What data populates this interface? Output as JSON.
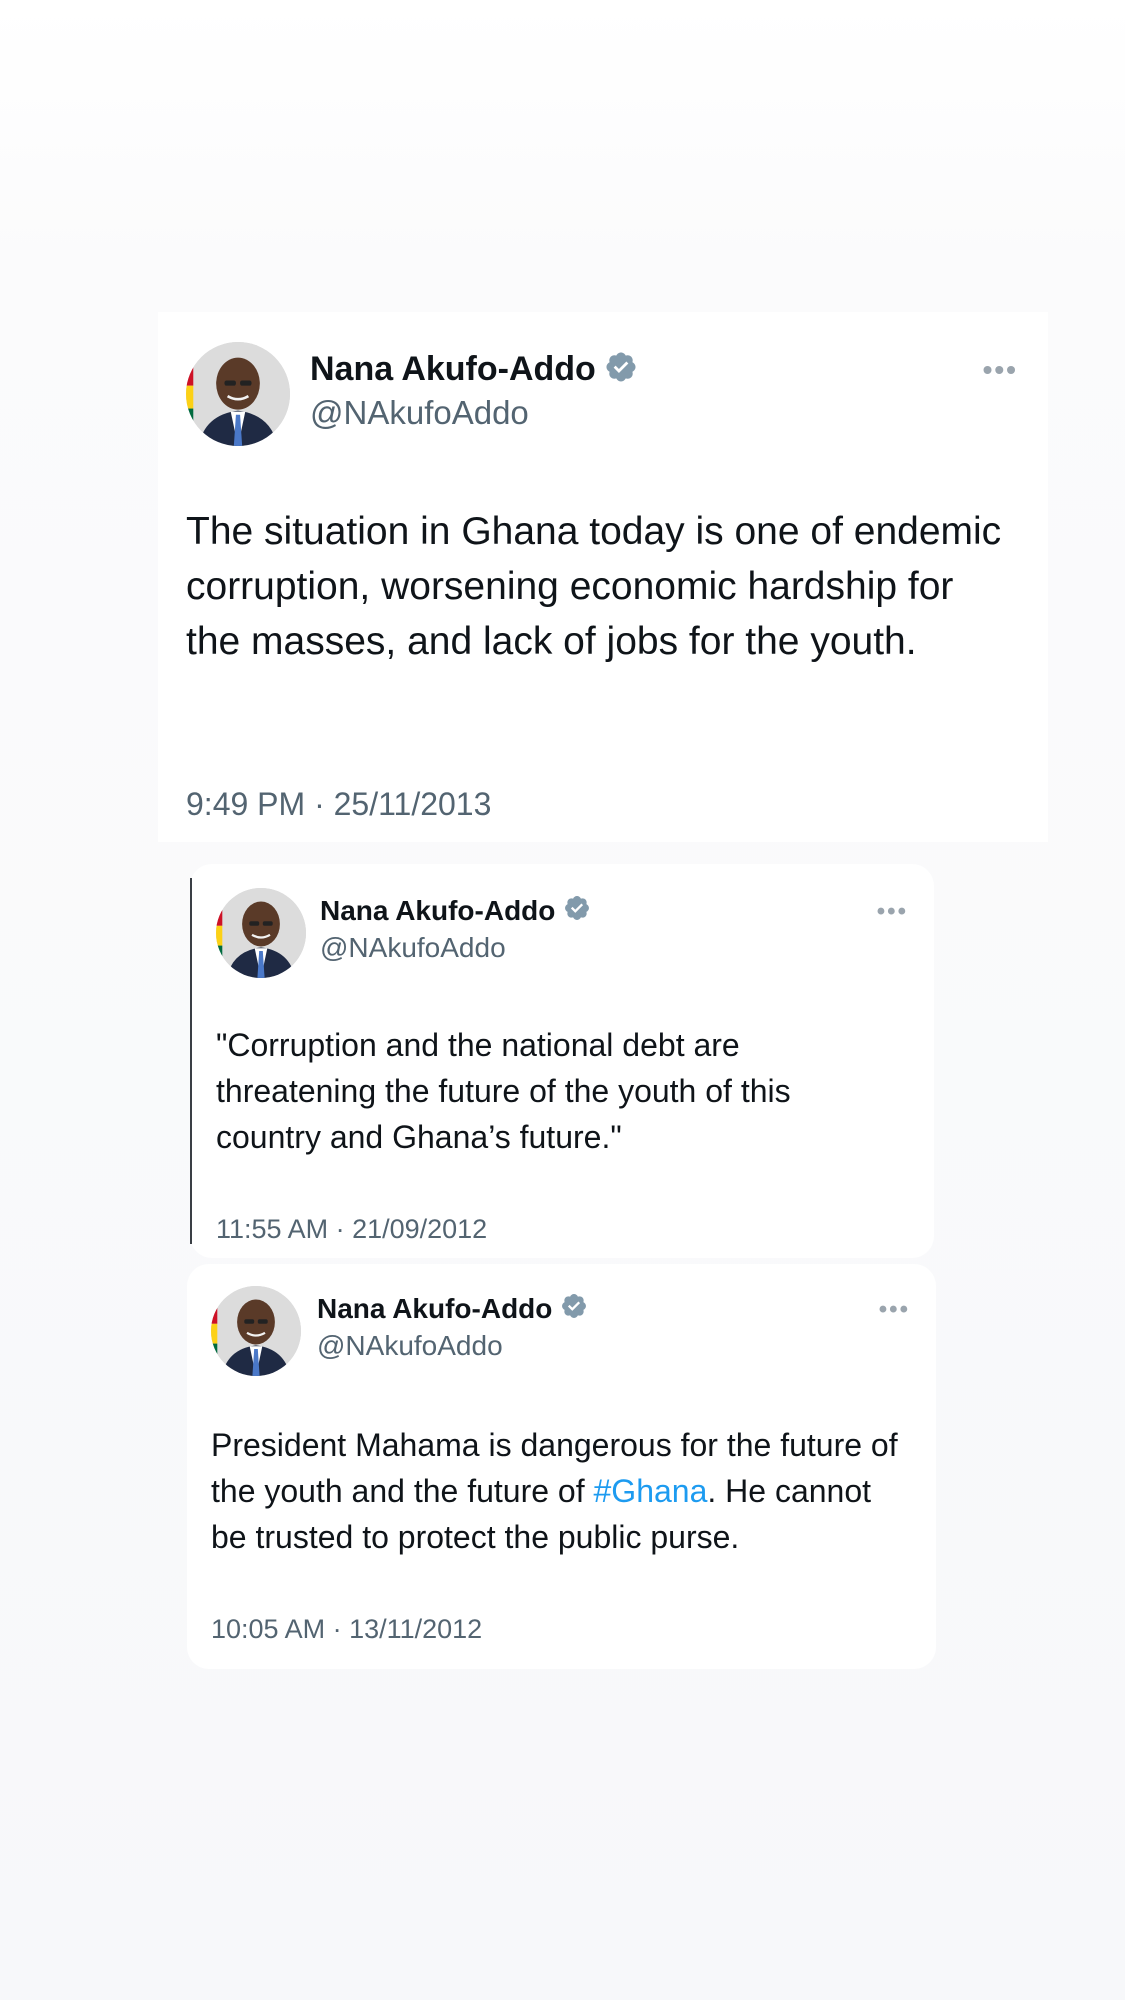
{
  "colors": {
    "verified_badge": "#829aab",
    "hashtag": "#1d9bf0",
    "secondary_text": "#536471",
    "primary_text": "#0f1419"
  },
  "tweets": [
    {
      "author_name": "Nana Akufo-Addo",
      "handle": "@NAkufoAddo",
      "verified": true,
      "avatar": "profile-photo",
      "more_icon": "more-options-icon",
      "text": "The situation in Ghana today is one of endemic corruption, worsening economic hardship for the masses, and lack of jobs for the youth.",
      "timestamp": "9:49 PM · 25/11/2013"
    },
    {
      "author_name": "Nana Akufo-Addo",
      "handle": "@NAkufoAddo",
      "verified": true,
      "avatar": "profile-photo",
      "more_icon": "more-options-icon",
      "text": "\"Corruption and the national debt are threatening the future of the youth of this country and Ghana’s future.\"",
      "timestamp": "11:55 AM · 21/09/2012"
    },
    {
      "author_name": "Nana Akufo-Addo",
      "handle": "@NAkufoAddo",
      "verified": true,
      "avatar": "profile-photo",
      "more_icon": "more-options-icon",
      "text_before": "President Mahama is dangerous for the future of the youth and the future of ",
      "hashtag": "#Ghana",
      "text_after": ". He cannot be trusted to protect the public purse.",
      "timestamp": "10:05 AM · 13/11/2012"
    }
  ]
}
